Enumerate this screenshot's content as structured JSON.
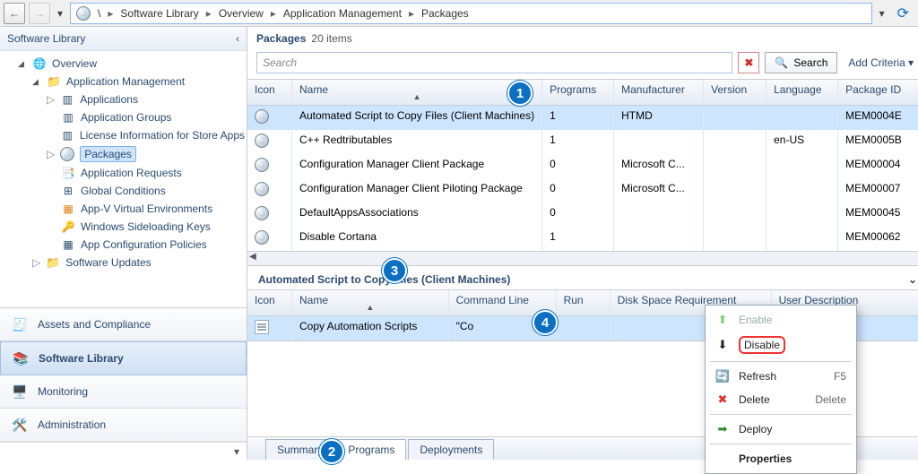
{
  "topnav": {
    "back_icon": "←",
    "fwd_icon": "→",
    "drop_icon": "▾",
    "refresh_icon": "⟳"
  },
  "breadcrumbs": [
    "\\",
    "Software Library",
    "Overview",
    "Application Management",
    "Packages"
  ],
  "crumb_sep": "▸",
  "left_panel_title": "Software Library",
  "tree": {
    "overview": "Overview",
    "app_mgmt": "Application Management",
    "items": {
      "applications": "Applications",
      "app_groups": "Application Groups",
      "license": "License Information for Store Apps",
      "packages": "Packages",
      "app_requests": "Application Requests",
      "global_cond": "Global Conditions",
      "appv": "App-V Virtual Environments",
      "sideload": "Windows Sideloading Keys",
      "app_cfg": "App Configuration Policies"
    },
    "sw_updates": "Software Updates"
  },
  "workspaces": {
    "assets": "Assets and Compliance",
    "swlib": "Software Library",
    "monitoring": "Monitoring",
    "admin": "Administration"
  },
  "packages_header": "Packages",
  "packages_count": "20 items",
  "search_placeholder": "Search",
  "x_icon": "✖",
  "search_icon": "🔍",
  "search_label": "Search",
  "add_criteria": "Add Criteria",
  "grid_headers": {
    "icon": "Icon",
    "name": "Name",
    "programs": "Programs",
    "manufacturer": "Manufacturer",
    "version": "Version",
    "language": "Language",
    "package_id": "Package ID"
  },
  "sort_indicator": "▲",
  "rows": [
    {
      "name": "Automated Script to Copy Files (Client Machines)",
      "programs": "1",
      "manufacturer": "HTMD",
      "version": "",
      "language": "",
      "package_id": "MEM0004E"
    },
    {
      "name": "C++ Redtributables",
      "programs": "1",
      "manufacturer": "",
      "version": "",
      "language": "en-US",
      "package_id": "MEM0005B"
    },
    {
      "name": "Configuration Manager Client Package",
      "programs": "0",
      "manufacturer": "Microsoft C...",
      "version": "",
      "language": "",
      "package_id": "MEM00004"
    },
    {
      "name": "Configuration Manager Client Piloting Package",
      "programs": "0",
      "manufacturer": "Microsoft C...",
      "version": "",
      "language": "",
      "package_id": "MEM00007"
    },
    {
      "name": "DefaultAppsAssociations",
      "programs": "0",
      "manufacturer": "",
      "version": "",
      "language": "",
      "package_id": "MEM00045"
    },
    {
      "name": "Disable Cortana",
      "programs": "1",
      "manufacturer": "",
      "version": "",
      "language": "",
      "package_id": "MEM00062"
    }
  ],
  "detail_title": "Automated Script to Copy Files (Client Machines)",
  "detail_headers": {
    "icon": "Icon",
    "name": "Name",
    "cmd": "Command Line",
    "run": "Run",
    "disk": "Disk Space Requirement",
    "desc": "User Description"
  },
  "detail_row": {
    "name": "Copy Automation Scripts",
    "cmd": "\"Co"
  },
  "detail_sort": "▲",
  "context": {
    "enable": "Enable",
    "disable": "Disable",
    "refresh": "Refresh",
    "delete": "Delete",
    "deploy": "Deploy",
    "properties": "Properties",
    "kb_refresh": "F5",
    "kb_delete": "Delete"
  },
  "tabs": {
    "summary": "Summary",
    "programs": "Programs",
    "deployments": "Deployments"
  },
  "callouts": {
    "1": "1",
    "2": "2",
    "3": "3",
    "4": "4"
  }
}
